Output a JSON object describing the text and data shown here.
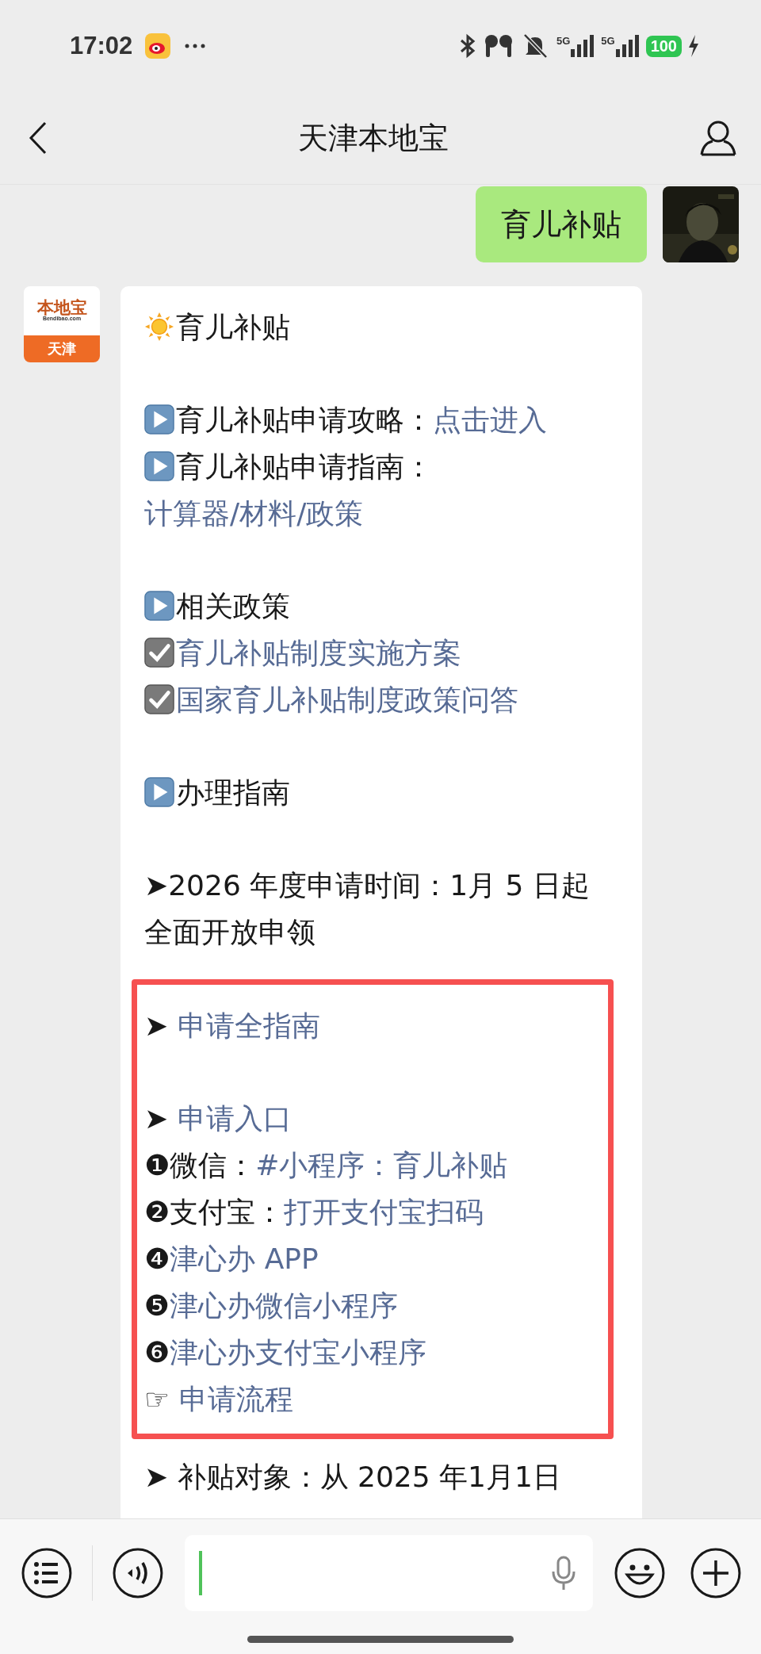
{
  "status_bar": {
    "time": "17:02",
    "signal_labels": [
      "5G",
      "5G"
    ],
    "battery": "100"
  },
  "header": {
    "title": "天津本地宝"
  },
  "chat": [
    {
      "kind": "sent",
      "text": "育儿补贴"
    },
    {
      "kind": "received",
      "logo": {
        "brand": "本地宝",
        "domain": "Bendibao.com",
        "city": "天津"
      },
      "lines": [
        {
          "kind": "sun",
          "parts": [
            {
              "text": "育儿补贴",
              "link": false
            }
          ]
        },
        {
          "kind": "gap"
        },
        {
          "kind": "play",
          "parts": [
            {
              "text": "育儿补贴申请攻略：",
              "link": false
            },
            {
              "text": "点击进入",
              "link": true
            }
          ]
        },
        {
          "kind": "play",
          "parts": [
            {
              "text": "育儿补贴申请指南：",
              "link": false
            },
            {
              "text": "计算器/材料/政策",
              "link": true
            }
          ]
        },
        {
          "kind": "gap"
        },
        {
          "kind": "play",
          "parts": [
            {
              "text": "相关政策",
              "link": false
            }
          ]
        },
        {
          "kind": "check",
          "parts": [
            {
              "text": "育儿补贴制度实施方案",
              "link": true
            }
          ]
        },
        {
          "kind": "check",
          "parts": [
            {
              "text": "国家育儿补贴制度政策问答",
              "link": true
            }
          ]
        },
        {
          "kind": "gap"
        },
        {
          "kind": "play",
          "parts": [
            {
              "text": "办理指南",
              "link": false
            }
          ]
        },
        {
          "kind": "gap"
        },
        {
          "kind": "text",
          "parts": [
            {
              "text": "➤2026 年度申请时间：1月 5 日起全面开放申领",
              "link": false
            }
          ]
        },
        {
          "kind": "box",
          "lines": [
            {
              "kind": "text",
              "parts": [
                {
                  "text": "➤ ",
                  "link": false
                },
                {
                  "text": "申请全指南",
                  "link": true
                }
              ]
            },
            {
              "kind": "gap"
            },
            {
              "kind": "text",
              "parts": [
                {
                  "text": "➤ ",
                  "link": false
                },
                {
                  "text": "申请入口",
                  "link": true
                }
              ]
            },
            {
              "kind": "text",
              "parts": [
                {
                  "text": "❶微信：",
                  "link": false
                },
                {
                  "text": "#小程序：育儿补贴",
                  "link": true
                }
              ]
            },
            {
              "kind": "text",
              "parts": [
                {
                  "text": "❷支付宝：",
                  "link": false
                },
                {
                  "text": "打开支付宝扫码",
                  "link": true
                }
              ]
            },
            {
              "kind": "text",
              "parts": [
                {
                  "text": "❹",
                  "link": false
                },
                {
                  "text": "津心办 APP",
                  "link": true
                }
              ]
            },
            {
              "kind": "text",
              "parts": [
                {
                  "text": "❺",
                  "link": false
                },
                {
                  "text": "津心办微信小程序",
                  "link": true
                }
              ]
            },
            {
              "kind": "text",
              "parts": [
                {
                  "text": "❻",
                  "link": false
                },
                {
                  "text": "津心办支付宝小程序",
                  "link": true
                }
              ]
            },
            {
              "kind": "text",
              "parts": [
                {
                  "text": "☞ ",
                  "link": false
                },
                {
                  "text": "申请流程",
                  "link": true
                }
              ]
            }
          ]
        },
        {
          "kind": "text",
          "parts": [
            {
              "text": "➤ 补贴对象：从 2025 年1月1日",
              "link": false
            }
          ]
        }
      ]
    }
  ]
}
